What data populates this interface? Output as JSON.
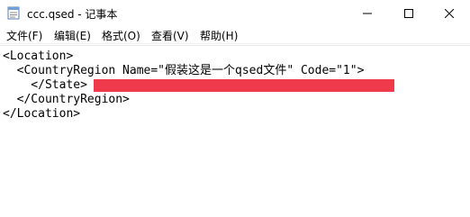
{
  "window": {
    "title": "ccc.qsed - 记事本",
    "controls": {
      "minimize": "minimize",
      "maximize": "maximize",
      "close": "close"
    }
  },
  "menu": {
    "items": [
      {
        "label": "文件(F)"
      },
      {
        "label": "编辑(E)"
      },
      {
        "label": "格式(O)"
      },
      {
        "label": "查看(V)"
      },
      {
        "label": "帮助(H)"
      }
    ]
  },
  "editor": {
    "lines": [
      "<Location>",
      "  <CountryRegion Name=\"假装这是一个qsed文件\" Code=\"1\">",
      "    </State>",
      "  </CountryRegion>",
      "</Location>"
    ],
    "redaction_color": "#ee3a4a"
  }
}
